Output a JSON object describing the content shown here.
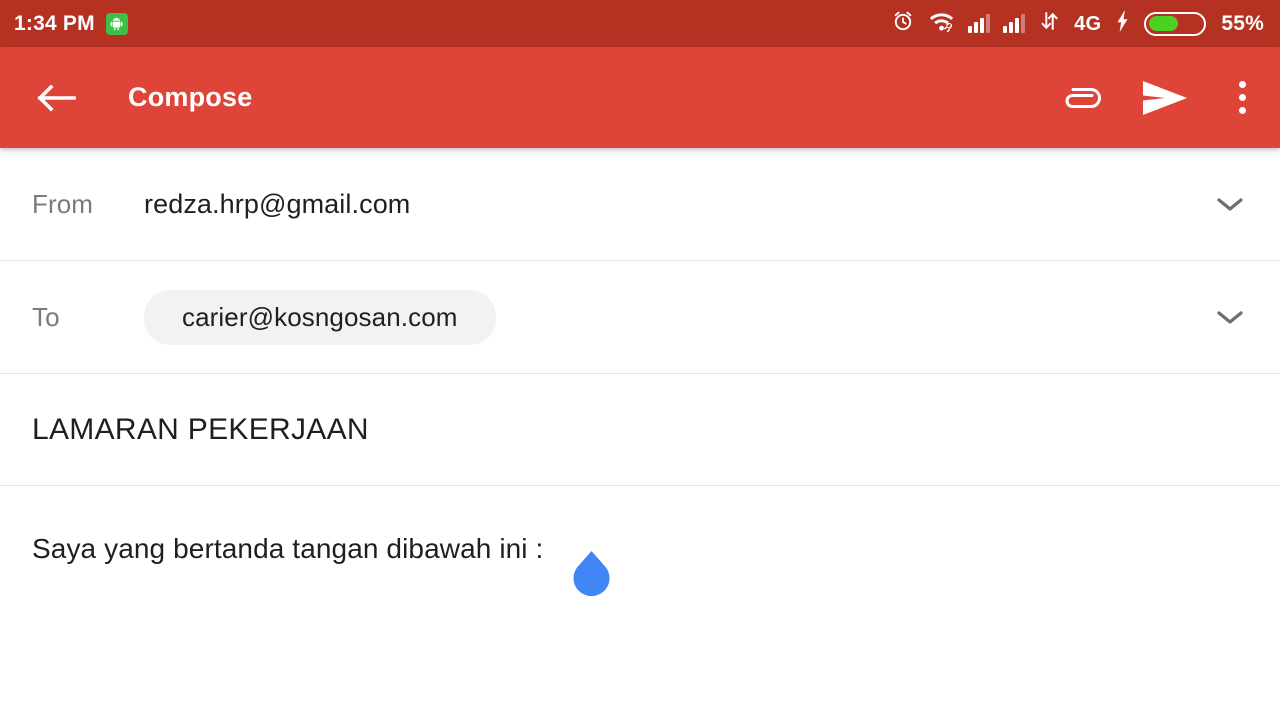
{
  "status_bar": {
    "time": "1:34 PM",
    "notification_icon": "android-robot-icon",
    "alarm_icon": "alarm-clock-icon",
    "wifi_icon": "wifi-icon",
    "signal_icon_1": "cellular-signal-icon",
    "signal_icon_2": "cellular-signal-icon",
    "data_transfer_icon": "data-transfer-arrows-icon",
    "network_type": "4G",
    "charging_icon": "charging-bolt-icon",
    "battery_percent": "55%",
    "battery_level": 55,
    "background_color": "#b53122",
    "foreground_color": "#ffffff"
  },
  "toolbar": {
    "back_icon": "back-arrow-icon",
    "title": "Compose",
    "attach_icon": "paperclip-icon",
    "send_icon": "send-paper-plane-icon",
    "overflow_icon": "more-vertical-icon",
    "background_color": "#de4437"
  },
  "compose": {
    "from": {
      "label": "From",
      "value": "redza.hrp@gmail.com",
      "expand_icon": "chevron-down-icon"
    },
    "to": {
      "label": "To",
      "recipients": [
        "carier@kosngosan.com"
      ],
      "expand_icon": "chevron-down-icon"
    },
    "subject": {
      "value": "LAMARAN PEKERJAAN"
    },
    "body": {
      "value": "Saya yang bertanda tangan dibawah ini :",
      "cursor_handle_icon": "text-cursor-handle-icon",
      "cursor_handle_color": "#4285f4"
    }
  }
}
